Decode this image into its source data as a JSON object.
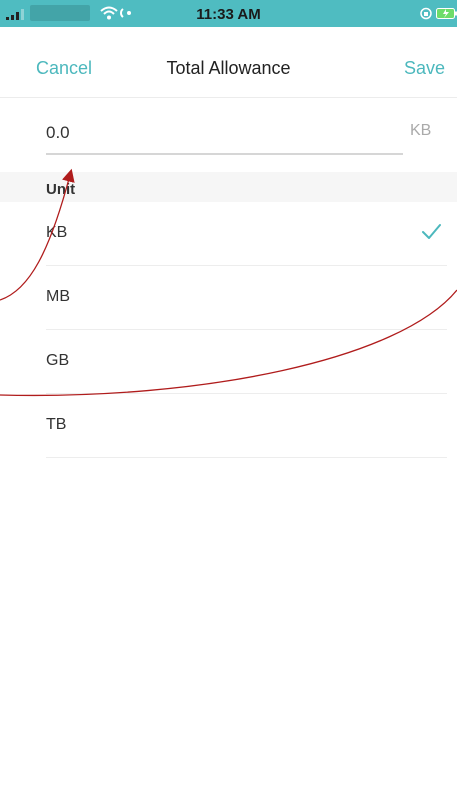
{
  "status_bar": {
    "time": "11:33 AM",
    "background_color": "#4fbcc1",
    "icons": [
      "signal-icon",
      "wifi-icon",
      "sync-icon",
      "lock-rotation-icon",
      "battery-icon"
    ]
  },
  "nav": {
    "cancel_label": "Cancel",
    "title": "Total Allowance",
    "save_label": "Save",
    "accent_color": "#4cb8bd"
  },
  "allowance_input": {
    "value": "0.0",
    "unit_suffix": "KB"
  },
  "unit_section": {
    "header": "Unit",
    "options": [
      {
        "label": "KB",
        "selected": true
      },
      {
        "label": "MB",
        "selected": false
      },
      {
        "label": "GB",
        "selected": false
      },
      {
        "label": "TB",
        "selected": false
      }
    ]
  }
}
